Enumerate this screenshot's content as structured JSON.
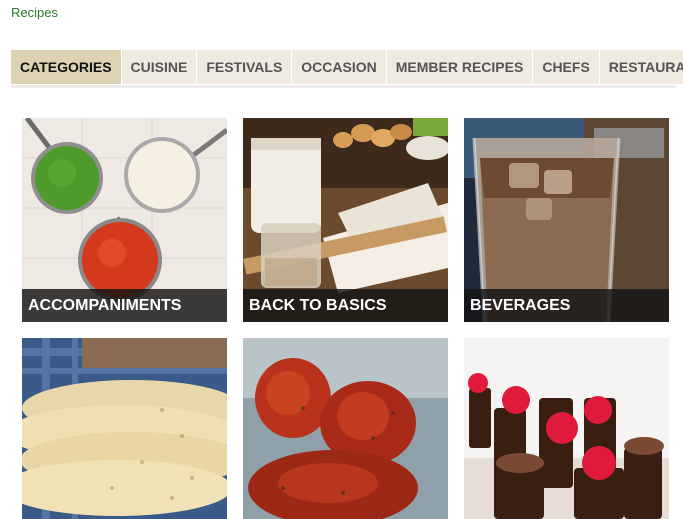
{
  "breadcrumb": "Recipes",
  "tabs": [
    {
      "label": "CATEGORIES",
      "active": true
    },
    {
      "label": "CUISINE",
      "active": false
    },
    {
      "label": "FESTIVALS",
      "active": false
    },
    {
      "label": "OCCASION",
      "active": false
    },
    {
      "label": "MEMBER RECIPES",
      "active": false
    },
    {
      "label": "CHEFS",
      "active": false
    },
    {
      "label": "RESTAURANT",
      "active": false
    }
  ],
  "categories": [
    {
      "label": "ACCOMPANIMENTS",
      "image": "chutneys-in-ladles-image"
    },
    {
      "label": "BACK TO BASICS",
      "image": "baking-ingredients-image"
    },
    {
      "label": "BEVERAGES",
      "image": "iced-coffee-image"
    },
    {
      "label": "",
      "image": "flatbreads-image"
    },
    {
      "label": "",
      "image": "tandoori-chicken-image"
    },
    {
      "label": "",
      "image": "raspberry-chocolate-cups-image"
    }
  ]
}
